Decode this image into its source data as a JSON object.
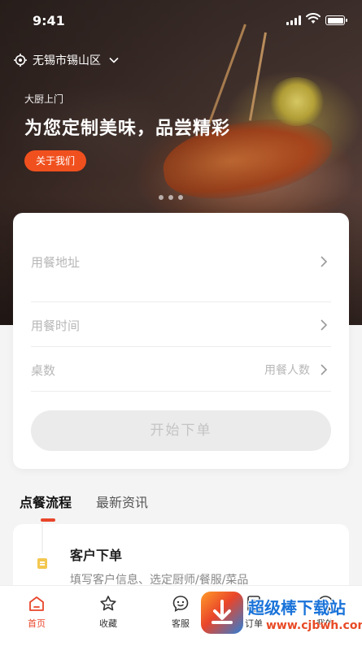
{
  "status_bar": {
    "time": "9:41"
  },
  "location": {
    "city": "无锡市锡山区"
  },
  "banner": {
    "tagline": "大厨上门",
    "headline": "为您定制美味，品尝精彩",
    "about_label": "关于我们"
  },
  "form": {
    "address_label": "用餐地址",
    "time_label": "用餐时间",
    "tables_label": "桌数",
    "people_placeholder": "用餐人数",
    "submit_label": "开始下单"
  },
  "tabs": [
    {
      "label": "点餐流程",
      "active": true
    },
    {
      "label": "最新资讯",
      "active": false
    }
  ],
  "steps": [
    {
      "title": "客户下单",
      "desc": "填写客户信息、选定厨师/餐服/菜品"
    }
  ],
  "bottom_nav": [
    {
      "label": "首页",
      "icon": "home-icon",
      "active": true
    },
    {
      "label": "收藏",
      "icon": "star-icon",
      "active": false
    },
    {
      "label": "客服",
      "icon": "service-icon",
      "active": false
    },
    {
      "label": "订单",
      "icon": "order-icon",
      "active": false
    },
    {
      "label": "我的",
      "icon": "profile-icon",
      "active": false
    }
  ],
  "watermark": {
    "name": "超级棒下载站",
    "url": "www.cjbwh.com"
  },
  "colors": {
    "accent": "#f0501e",
    "nav_active": "#e8452a",
    "disabled_button": "#ebebeb"
  }
}
